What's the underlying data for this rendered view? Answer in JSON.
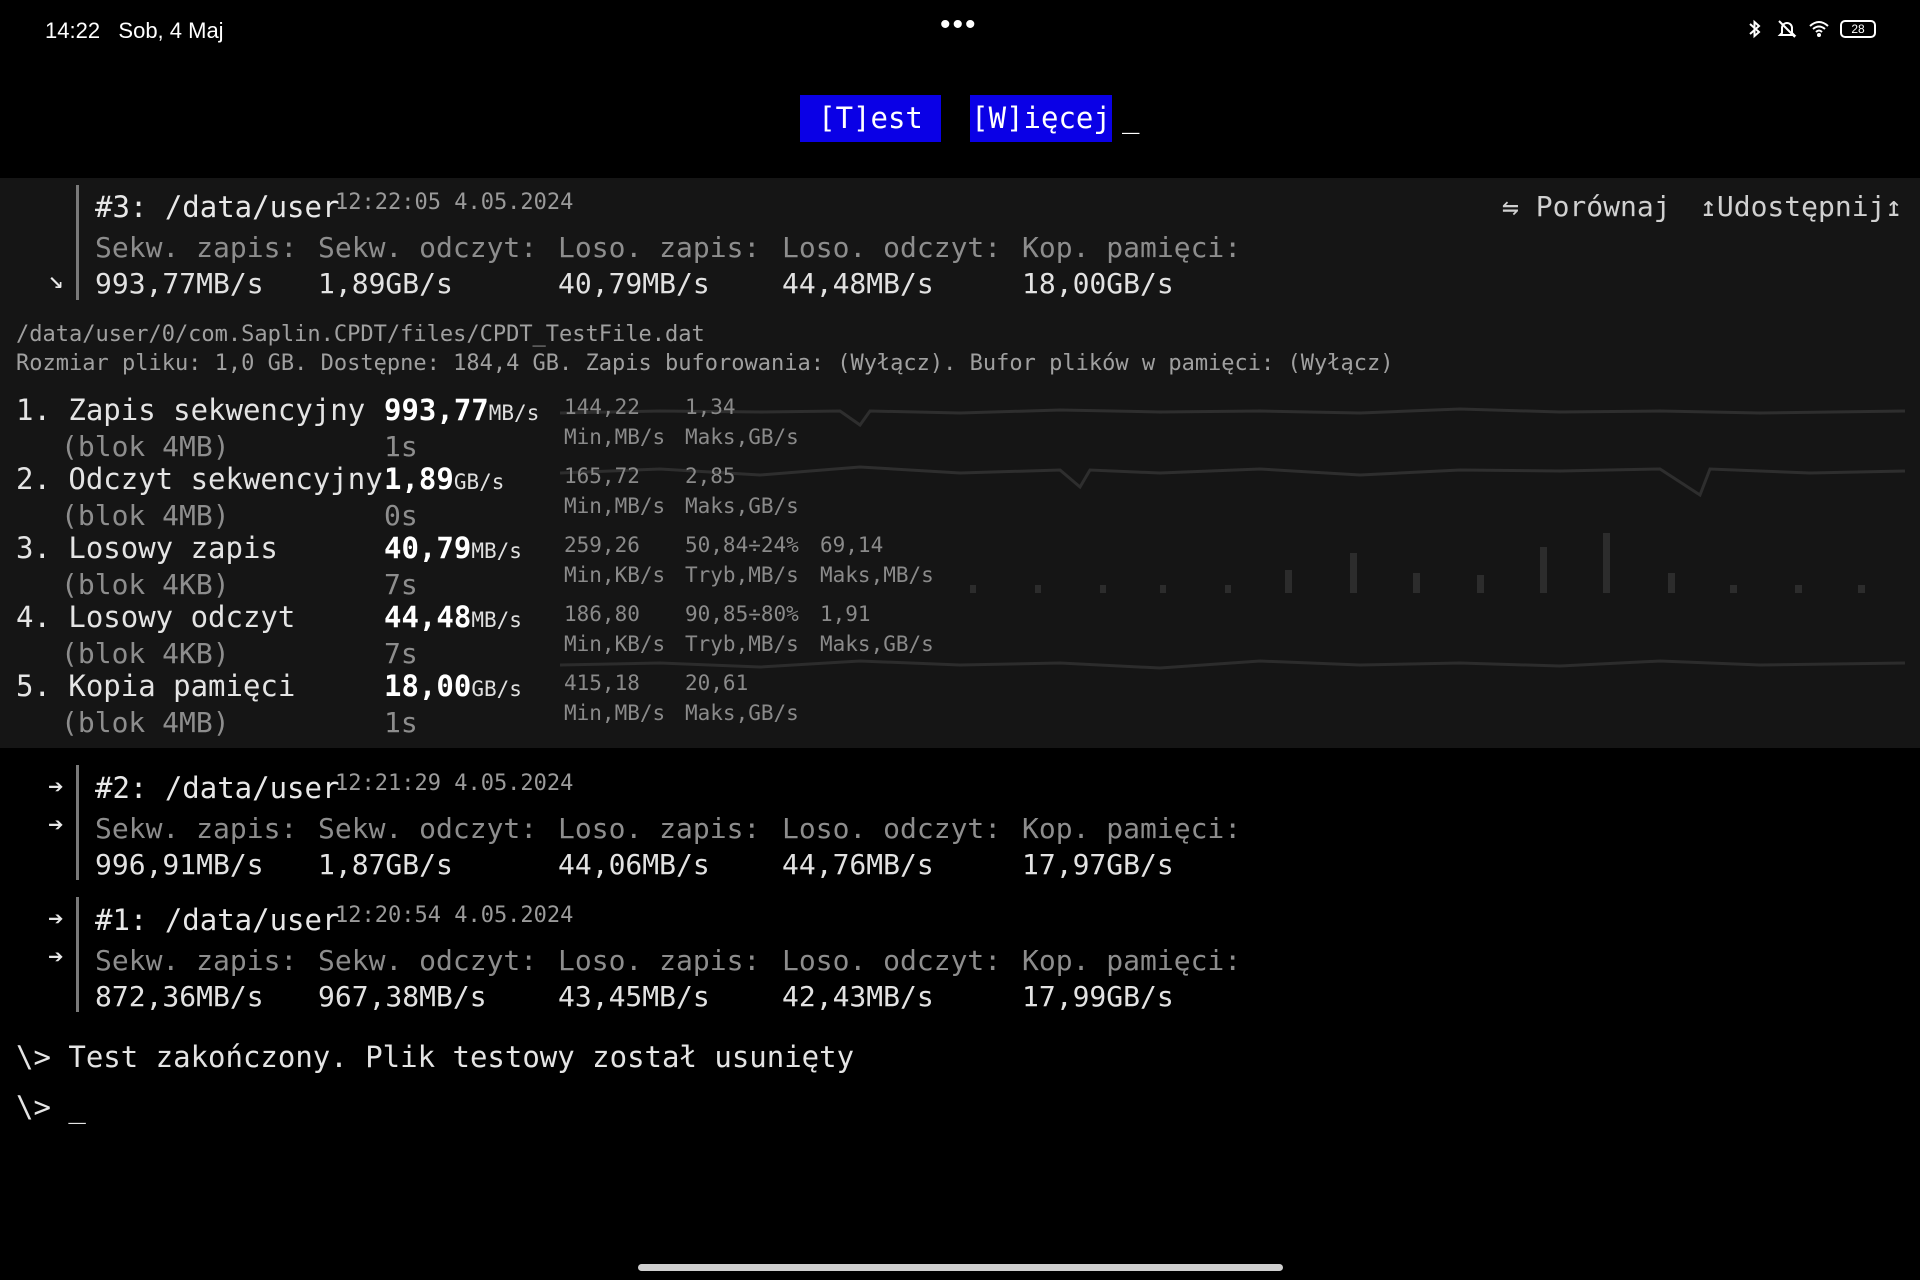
{
  "status": {
    "time": "14:22",
    "date": "Sob, 4 Maj",
    "battery": "28",
    "icons": [
      "bluetooth-icon",
      "mute-bell-icon",
      "wifi-icon",
      "battery-icon"
    ]
  },
  "toolbar": {
    "test_label": "[T]est",
    "more_label": "[W]ięcej",
    "cursor": "_"
  },
  "results": [
    {
      "id": "#3: /data/user",
      "time": "12:22:05 4.05.2024",
      "arrow": "↘",
      "labels": [
        "Sekw. zapis:",
        "Sekw. odczyt:",
        "Loso. zapis:",
        "Loso. odczyt:",
        "Kop. pamięci:"
      ],
      "values": [
        "993,77MB/s",
        "1,89GB/s",
        "40,79MB/s",
        "44,48MB/s",
        "18,00GB/s"
      ]
    },
    {
      "id": "#2: /data/user",
      "time": "12:21:29 4.05.2024",
      "arrows": [
        "➔",
        "➔"
      ],
      "labels": [
        "Sekw. zapis:",
        "Sekw. odczyt:",
        "Loso. zapis:",
        "Loso. odczyt:",
        "Kop. pamięci:"
      ],
      "values": [
        "996,91MB/s",
        "1,87GB/s",
        "44,06MB/s",
        "44,76MB/s",
        "17,97GB/s"
      ]
    },
    {
      "id": "#1: /data/user",
      "time": "12:20:54 4.05.2024",
      "arrows": [
        "➔",
        "➔"
      ],
      "labels": [
        "Sekw. zapis:",
        "Sekw. odczyt:",
        "Loso. zapis:",
        "Loso. odczyt:",
        "Kop. pamięci:"
      ],
      "values": [
        "872,36MB/s",
        "967,38MB/s",
        "43,45MB/s",
        "42,43MB/s",
        "17,99GB/s"
      ]
    }
  ],
  "actions": {
    "compare": "⇋ Porównaj",
    "share": "↥Udostępnij↥"
  },
  "info": {
    "path": "/data/user/0/com.Saplin.CPDT/files/CPDT_TestFile.dat",
    "details": "Rozmiar pliku: 1,0 GB. Dostępne: 184,4 GB. Zapis buforowania: (Wyłącz). Bufor plików w pamięci: (Wyłącz)"
  },
  "tests": [
    {
      "name": "1. Zapis sekwencyjny",
      "block": "(blok 4MB)",
      "value": "993,77",
      "unit": "MB/s",
      "duration": "1s",
      "stats": [
        {
          "top": "144,22",
          "bottom": "Min,MB/s"
        },
        {
          "top": "1,34",
          "bottom": "Maks,GB/s"
        }
      ]
    },
    {
      "name": "2. Odczyt sekwencyjny",
      "block": "(blok 4MB)",
      "value": "1,89",
      "unit": "GB/s",
      "duration": "0s",
      "stats": [
        {
          "top": "165,72",
          "bottom": "Min,MB/s"
        },
        {
          "top": "2,85",
          "bottom": "Maks,GB/s"
        }
      ]
    },
    {
      "name": "3. Losowy zapis",
      "block": "(blok 4KB)",
      "value": "40,79",
      "unit": "MB/s",
      "duration": "7s",
      "stats": [
        {
          "top": "259,26",
          "bottom": "Min,KB/s"
        },
        {
          "top": "50,84÷24%",
          "bottom": "Tryb,MB/s"
        },
        {
          "top": "69,14",
          "bottom": "Maks,MB/s"
        }
      ]
    },
    {
      "name": "4. Losowy odczyt",
      "block": "(blok 4KB)",
      "value": "44,48",
      "unit": "MB/s",
      "duration": "7s",
      "stats": [
        {
          "top": "186,80",
          "bottom": "Min,KB/s"
        },
        {
          "top": "90,85÷80%",
          "bottom": "Tryb,MB/s"
        },
        {
          "top": "1,91",
          "bottom": "Maks,GB/s"
        }
      ]
    },
    {
      "name": "5. Kopia pamięci",
      "block": "(blok 4MB)",
      "value": "18,00",
      "unit": "GB/s",
      "duration": "1s",
      "stats": [
        {
          "top": "415,18",
          "bottom": "Min,MB/s"
        },
        {
          "top": "20,61",
          "bottom": "Maks,GB/s"
        }
      ]
    }
  ],
  "console": {
    "message": "\\> Test zakończony. Plik testowy został usunięty",
    "prompt": "\\> _"
  }
}
